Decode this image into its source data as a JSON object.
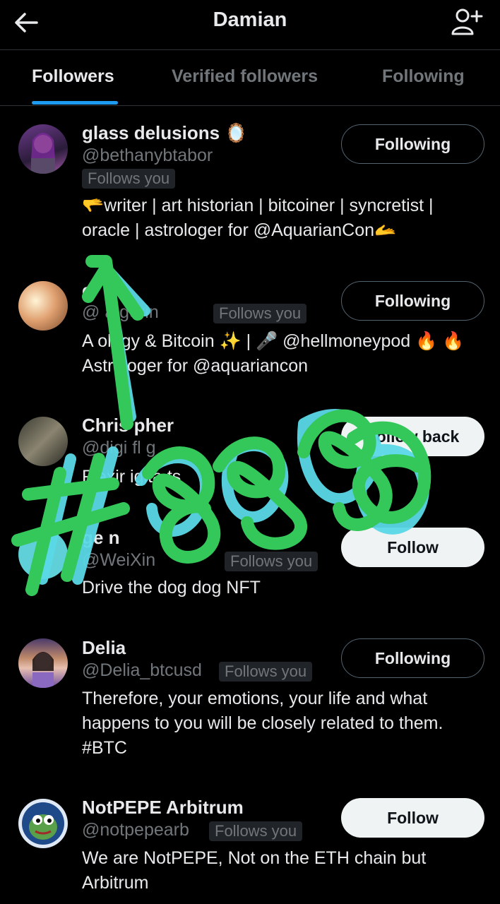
{
  "header": {
    "title": "Damian",
    "back_icon": "arrow-left-icon",
    "add_icon": "add-user-icon"
  },
  "tabs": [
    {
      "label": "Followers",
      "active": true
    },
    {
      "label": "Verified followers",
      "active": false
    },
    {
      "label": "Following",
      "active": false
    }
  ],
  "colors": {
    "accent": "#1d9bf0",
    "background": "#000000",
    "scribble_green": "#34c759",
    "scribble_cyan": "#5ad8e6"
  },
  "users": [
    {
      "name": "glass delusions",
      "name_emoji": "🪞",
      "handle": "@bethanybtabor",
      "follows_you": "Follows you",
      "bio": "🫳writer | art historian | bitcoiner | syncretist | oracle | astrologer for @AquarianCon🫴",
      "button": "Following"
    },
    {
      "name": "e",
      "handle": "@ a gerin",
      "follows_you": "Follows you",
      "bio": "A ology & Bitcoin ✨ | 🎤 @hellmoneypod 🔥 🔥 Astrologer for @aquariancon",
      "button": "Following"
    },
    {
      "name": "Chris pher",
      "handle": "@digi fl g",
      "follows_you": "",
      "bio": "Flexir igita ts",
      "button": "Follow back"
    },
    {
      "name": "ge n",
      "handle": "@WeiXin",
      "follows_you": "Follows you",
      "bio": "Drive the dog dog NFT",
      "button": "Follow"
    },
    {
      "name": "Delia",
      "handle": "@Delia_btcusd",
      "follows_you": "Follows you",
      "bio": "Therefore, your emotions, your life and what happens to you will be closely related to them. #BTC",
      "button": "Following"
    },
    {
      "name": "NotPEPE Arbitrum",
      "handle": "@notpepearb",
      "follows_you": "Follows you",
      "bio": "We are NotPEPE, Not on the ETH chain but Arbitrum",
      "button": "Follow"
    }
  ]
}
